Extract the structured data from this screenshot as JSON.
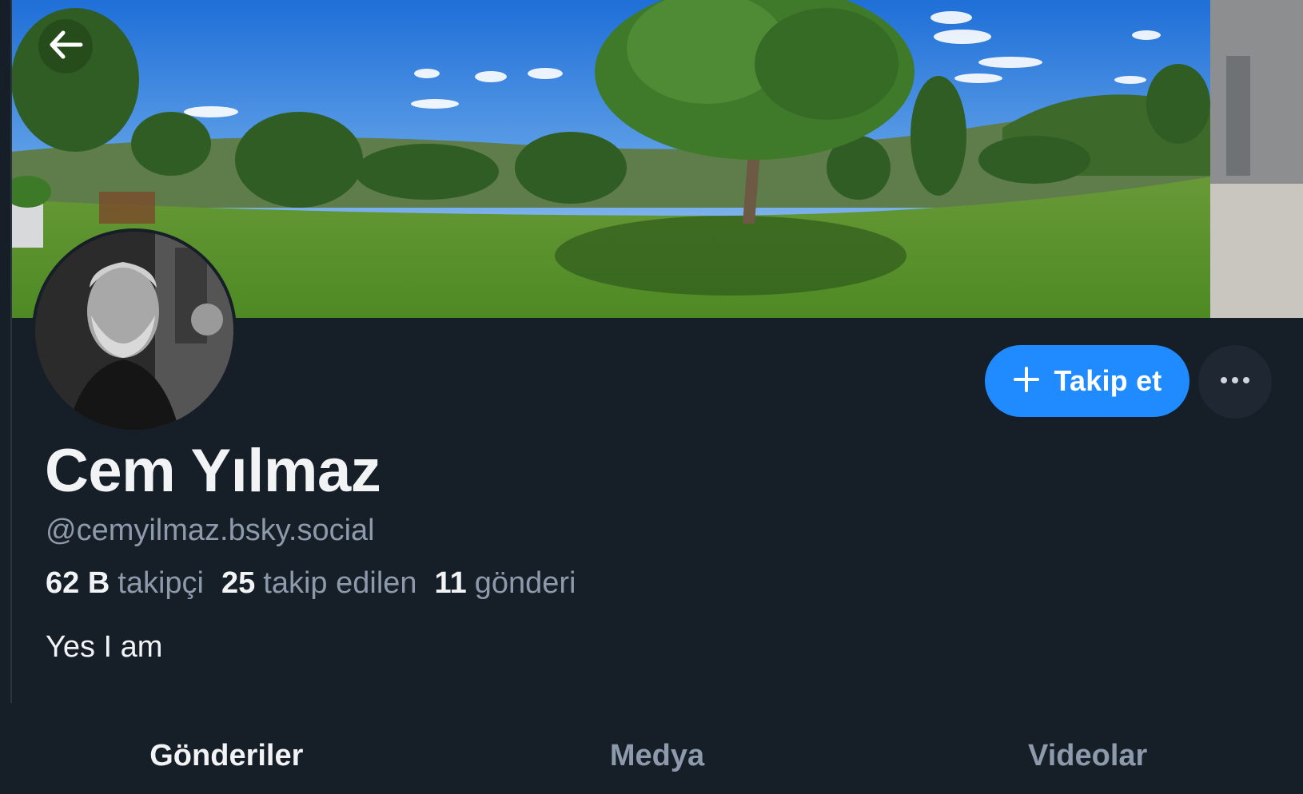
{
  "profile": {
    "display_name": "Cem Yılmaz",
    "handle": "@cemyilmaz.bsky.social",
    "bio": "Yes I am"
  },
  "stats": {
    "followers_count": "62 B",
    "followers_label": "takipçi",
    "following_count": "25",
    "following_label": "takip edilen",
    "posts_count": "11",
    "posts_label": "gönderi"
  },
  "actions": {
    "follow_label": "Takip et"
  },
  "tabs": [
    {
      "label": "Gönderiler",
      "active": true
    },
    {
      "label": "Medya",
      "active": false
    },
    {
      "label": "Videolar",
      "active": false
    }
  ],
  "colors": {
    "background": "#161e27",
    "accent": "#208bfe",
    "text_primary": "#f1f3f5",
    "text_secondary": "#8d9aab"
  },
  "icons": {
    "back": "arrow-left-icon",
    "follow": "plus-icon",
    "more": "ellipsis-icon"
  }
}
